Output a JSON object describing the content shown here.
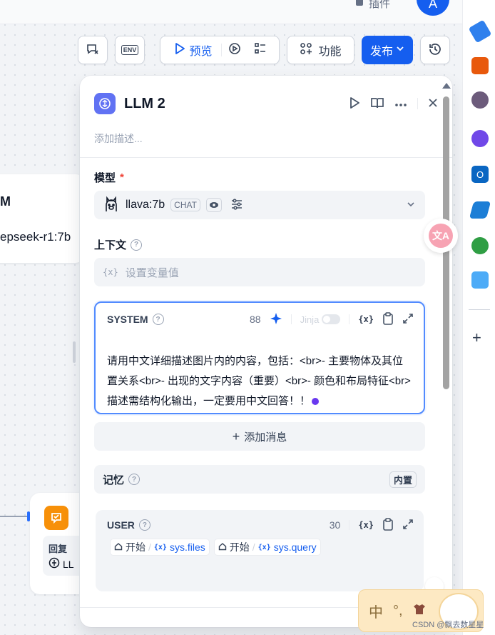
{
  "topbar": {
    "plugin_label": "插件",
    "avatar_letter": "A"
  },
  "toolbar": {
    "preview_label": "预览",
    "features_label": "功能",
    "publish_label": "发布",
    "env_label": "ENV"
  },
  "canvas": {
    "llm_node_title": "M",
    "llm_node_model": "epseek-r1:7b",
    "answer_label": "回复",
    "answer_ref": "LL"
  },
  "panel": {
    "title": "LLM 2",
    "description_placeholder": "添加描述...",
    "model": {
      "label": "模型",
      "required_mark": "*",
      "name": "llava:7b",
      "mode_badge": "CHAT"
    },
    "context": {
      "label": "上下文",
      "placeholder": "设置变量值",
      "var_symbol": "{x}"
    },
    "system": {
      "title": "SYSTEM",
      "count": "88",
      "jinja_label": "Jinja",
      "var_symbol": "{x}",
      "text": "请用中文详细描述图片内的内容，包括：<br>- 主要物体及其位置关系<br>- 出现的文字内容（重要）<br>- 颜色和布局特征<br>描述需结构化输出，一定要用中文回答！！"
    },
    "add_message_label": "添加消息",
    "memory": {
      "label": "记忆",
      "builtin_badge": "内置"
    },
    "user": {
      "title": "USER",
      "count": "30",
      "var_symbol": "{x}",
      "tags": [
        {
          "node": "开始",
          "var": "sys.files"
        },
        {
          "node": "开始",
          "var": "sys.query"
        }
      ]
    }
  },
  "widgets": {
    "ime_char": "中",
    "watermark": "CSDN @飘去数星星"
  },
  "colors": {
    "primary": "#155eef",
    "system_border": "#528bff",
    "answer_node": "#f79009",
    "llm_logo": "#6172f3"
  }
}
